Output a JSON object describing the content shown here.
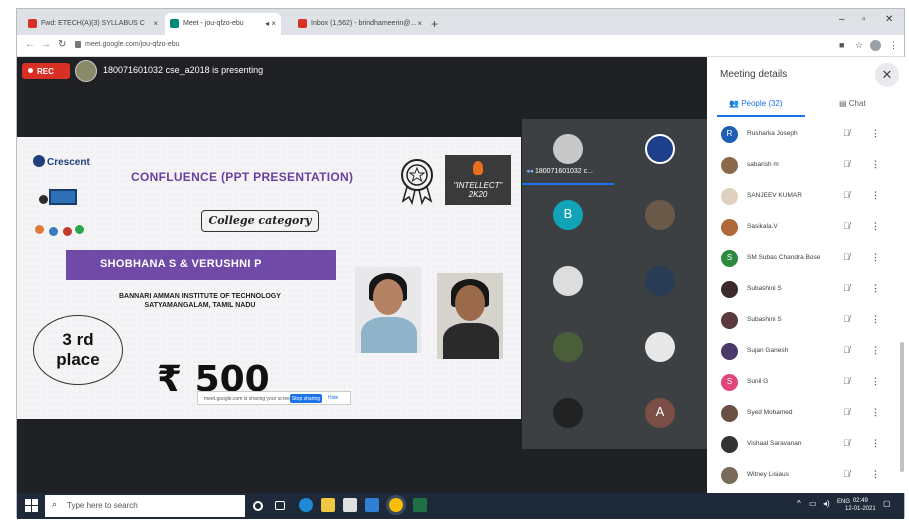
{
  "browser": {
    "tabs": [
      {
        "label": "Fwd: ETECH(A)(3) SYLLABUS C",
        "active": false
      },
      {
        "label": "Meet - jou-qfzo-ebu",
        "active": true
      },
      {
        "label": "",
        "active": false
      },
      {
        "label": "Inbox (1,562) - brindhameerin@...",
        "active": false
      }
    ],
    "url": "meet.google.com/jou-qfzo-ebu",
    "window_controls": [
      "–",
      "▫",
      "✕"
    ]
  },
  "meet": {
    "rec_label": "REC",
    "presenting_text": "180071601032 cse_a2018 is presenting",
    "tiles": [
      {
        "label": "180071601032 c...",
        "avatar_color": "#c8c8c8",
        "letter": "",
        "active": true
      },
      {
        "label": "",
        "avatar_color": "#1e3f8a",
        "letter": ""
      },
      {
        "label": "",
        "avatar_color": "#12a3b8",
        "letter": "B"
      },
      {
        "label": "",
        "avatar_color": "#6b5a4a",
        "letter": ""
      },
      {
        "label": "",
        "avatar_color": "#ddd",
        "letter": ""
      },
      {
        "label": "",
        "avatar_color": "#2a3b55",
        "letter": ""
      },
      {
        "label": "",
        "avatar_color": "#4a5e3a",
        "letter": ""
      },
      {
        "label": "",
        "avatar_color": "#e8e8e8",
        "letter": ""
      },
      {
        "label": "",
        "avatar_color": "#222",
        "letter": ""
      },
      {
        "label": "",
        "avatar_color": "#7b4f45",
        "letter": "A"
      }
    ]
  },
  "slide": {
    "logo_text": "Crescent",
    "title": "CONFLUENCE (PPT PRESENTATION)",
    "event_badge": "\"INTELLECT\"\n2K20",
    "category": "College category",
    "names": "SHOBHANA S & VERUSHNI P",
    "institute_line1": "BANNARI AMMAN INSTITUTE OF TECHNOLOGY",
    "institute_line2": "SATYAMANGALAM, TAMIL NADU",
    "place_line1": "3 rd",
    "place_line2": "place",
    "prize": "₹ 500",
    "share_text": "meet.google.com is sharing your screen.",
    "share_stop": "Stop sharing",
    "share_hide": "Hide"
  },
  "panel": {
    "title": "Meeting details",
    "close_icon": "close-icon",
    "people_tab": "People (32)",
    "chat_tab": "Chat",
    "people": [
      {
        "name": "Rusharka Joseph",
        "letter": "R",
        "color": "#1e5fb5"
      },
      {
        "name": "sabarish m",
        "letter": "",
        "color": "#8a6a4a"
      },
      {
        "name": "SANJEEV KUMAR",
        "letter": "",
        "color": "#e0d0c0"
      },
      {
        "name": "Sasikala.V",
        "letter": "",
        "color": "#b06a3a"
      },
      {
        "name": "SM Subas Chandra Bose",
        "letter": "S",
        "color": "#2e8a3e"
      },
      {
        "name": "Subashini S",
        "letter": "",
        "color": "#3a2a2a"
      },
      {
        "name": "Subashini S",
        "letter": "",
        "color": "#5a3a3a"
      },
      {
        "name": "Sujan Ganesh",
        "letter": "",
        "color": "#4a3a6a"
      },
      {
        "name": "Sunil G",
        "letter": "S",
        "color": "#e0457b"
      },
      {
        "name": "Syed Mohamed",
        "letter": "",
        "color": "#6a5040"
      },
      {
        "name": "Vishaal Saravanan",
        "letter": "",
        "color": "#333"
      },
      {
        "name": "Witney Lisiaus",
        "letter": "",
        "color": "#7a6a5a"
      }
    ]
  },
  "taskbar": {
    "search_placeholder": "Type here to search",
    "time": "02:49",
    "date": "12-01-2021"
  }
}
